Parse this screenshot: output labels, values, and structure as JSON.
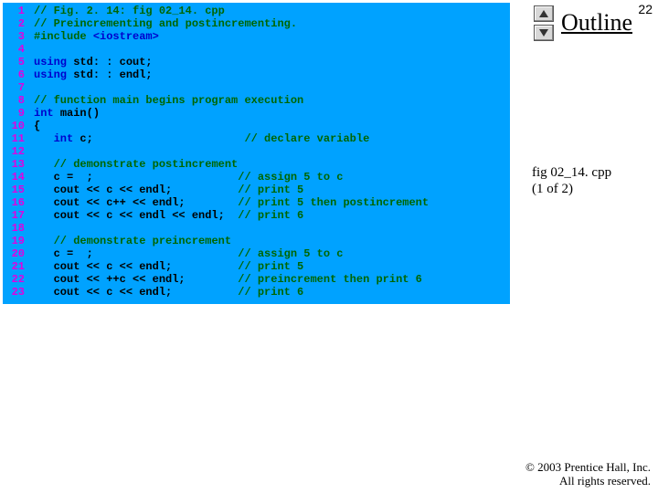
{
  "page_number": "22",
  "outline_label": "Outline",
  "fig_label_line1": "fig 02_14. cpp",
  "fig_label_line2": "(1 of 2)",
  "copyright_line1": "© 2003 Prentice Hall, Inc.",
  "copyright_line2": "All rights reserved.",
  "code": [
    {
      "n": "1",
      "seg": [
        {
          "c": "t-comment",
          "t": "// Fig. 2. 14: fig 02_14. cpp"
        }
      ]
    },
    {
      "n": "2",
      "seg": [
        {
          "c": "t-comment",
          "t": "// Preincrementing and postincrementing."
        }
      ]
    },
    {
      "n": "3",
      "seg": [
        {
          "c": "t-prep",
          "t": "#include "
        },
        {
          "c": "t-keyword",
          "t": "<iostream>"
        }
      ]
    },
    {
      "n": "4",
      "seg": []
    },
    {
      "n": "5",
      "seg": [
        {
          "c": "t-keyword",
          "t": "using "
        },
        {
          "c": "t-plain",
          "t": "std: : cout;"
        }
      ]
    },
    {
      "n": "6",
      "seg": [
        {
          "c": "t-keyword",
          "t": "using "
        },
        {
          "c": "t-plain",
          "t": "std: : endl;"
        }
      ]
    },
    {
      "n": "7",
      "seg": []
    },
    {
      "n": "8",
      "seg": [
        {
          "c": "t-comment",
          "t": "// function main begins program execution"
        }
      ]
    },
    {
      "n": "9",
      "seg": [
        {
          "c": "t-keyword",
          "t": "int "
        },
        {
          "c": "t-plain",
          "t": "main()"
        }
      ]
    },
    {
      "n": "10",
      "seg": [
        {
          "c": "t-plain",
          "t": "{"
        }
      ]
    },
    {
      "n": "11",
      "seg": [
        {
          "c": "t-plain",
          "t": "   "
        },
        {
          "c": "t-keyword",
          "t": "int "
        },
        {
          "c": "t-plain",
          "t": "c;                       "
        },
        {
          "c": "t-comment",
          "t": "// declare variable"
        }
      ]
    },
    {
      "n": "12",
      "seg": []
    },
    {
      "n": "13",
      "seg": [
        {
          "c": "t-plain",
          "t": "   "
        },
        {
          "c": "t-comment",
          "t": "// demonstrate postincrement"
        }
      ]
    },
    {
      "n": "14",
      "seg": [
        {
          "c": "t-plain",
          "t": "   c =  ;                      "
        },
        {
          "c": "t-comment",
          "t": "// assign 5 to c"
        }
      ]
    },
    {
      "n": "15",
      "seg": [
        {
          "c": "t-plain",
          "t": "   cout << c << endl;          "
        },
        {
          "c": "t-comment",
          "t": "// print 5"
        }
      ]
    },
    {
      "n": "16",
      "seg": [
        {
          "c": "t-plain",
          "t": "   cout << c++ << endl;        "
        },
        {
          "c": "t-comment",
          "t": "// print 5 then postincrement"
        }
      ]
    },
    {
      "n": "17",
      "seg": [
        {
          "c": "t-plain",
          "t": "   cout << c << endl << endl;  "
        },
        {
          "c": "t-comment",
          "t": "// print 6"
        }
      ]
    },
    {
      "n": "18",
      "seg": []
    },
    {
      "n": "19",
      "seg": [
        {
          "c": "t-plain",
          "t": "   "
        },
        {
          "c": "t-comment",
          "t": "// demonstrate preincrement"
        }
      ]
    },
    {
      "n": "20",
      "seg": [
        {
          "c": "t-plain",
          "t": "   c =  ;                      "
        },
        {
          "c": "t-comment",
          "t": "// assign 5 to c"
        }
      ]
    },
    {
      "n": "21",
      "seg": [
        {
          "c": "t-plain",
          "t": "   cout << c << endl;          "
        },
        {
          "c": "t-comment",
          "t": "// print 5"
        }
      ]
    },
    {
      "n": "22",
      "seg": [
        {
          "c": "t-plain",
          "t": "   cout << ++c << endl;        "
        },
        {
          "c": "t-comment",
          "t": "// preincrement then print 6"
        }
      ]
    },
    {
      "n": "23",
      "seg": [
        {
          "c": "t-plain",
          "t": "   cout << c << endl;          "
        },
        {
          "c": "t-comment",
          "t": "// print 6"
        }
      ]
    }
  ]
}
